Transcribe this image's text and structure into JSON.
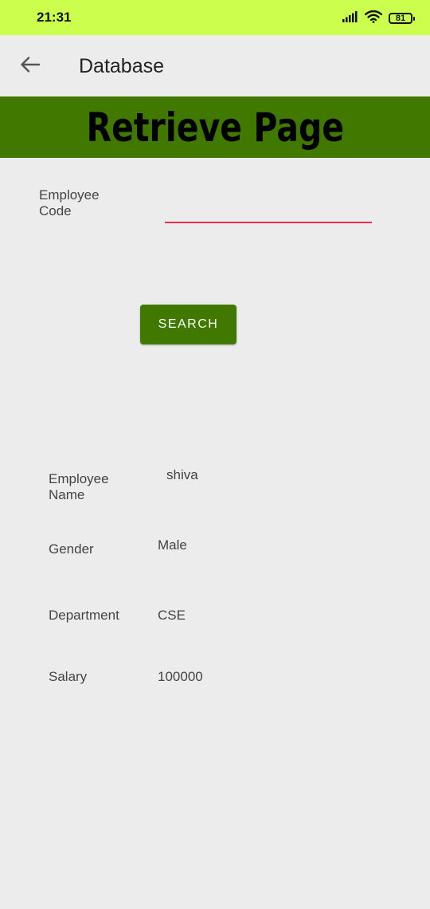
{
  "status_bar": {
    "time": "21:31",
    "battery_level": "81",
    "background_color": "#ccff4d"
  },
  "app_bar": {
    "title": "Database",
    "back_icon": "arrow-left-icon"
  },
  "banner": {
    "text": "Retrieve Page",
    "background_color": "#407800"
  },
  "form": {
    "code_label": "Employee Code",
    "code_value": "",
    "search_label": "SEARCH",
    "accent_color": "#e8324a"
  },
  "result": {
    "name_label": "Employee Name",
    "name_value": "shiva",
    "gender_label": "Gender",
    "gender_value": "Male",
    "department_label": "Department",
    "department_value": "CSE",
    "salary_label": "Salary",
    "salary_value": "100000"
  }
}
